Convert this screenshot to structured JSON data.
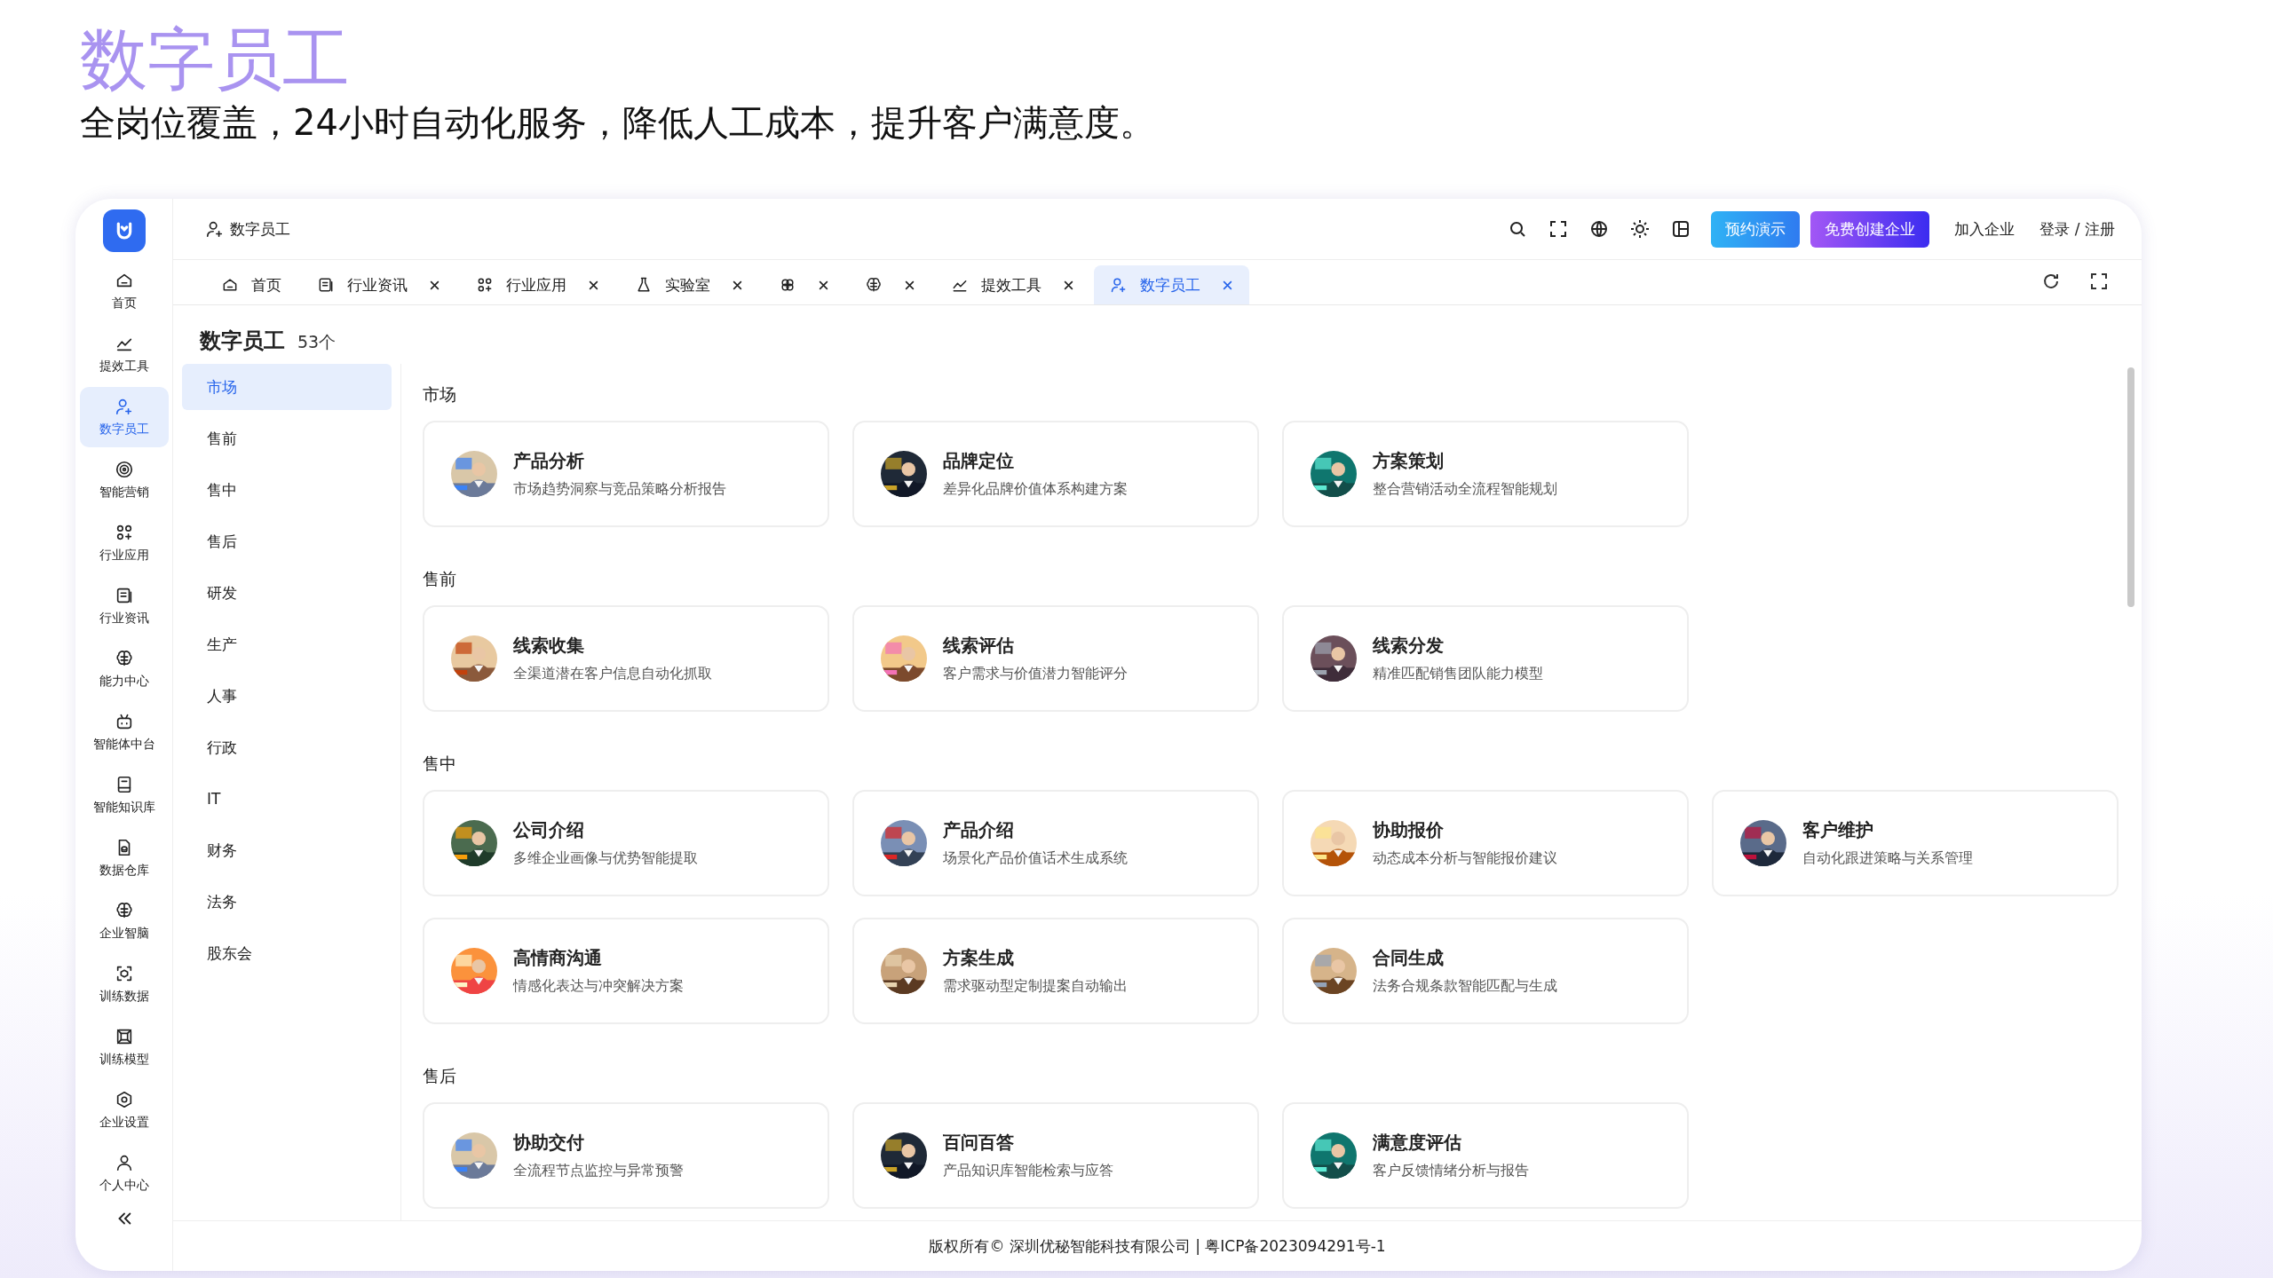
{
  "slide": {
    "title": "数字员工",
    "subtitle": "全岗位覆盖，24小时自动化服务，降低人工成本，提升客户满意度。"
  },
  "sidebar": {
    "items": [
      {
        "label": "首页",
        "selected": false
      },
      {
        "label": "提效工具",
        "selected": false
      },
      {
        "label": "数字员工",
        "selected": true
      },
      {
        "label": "智能营销",
        "selected": false
      },
      {
        "label": "行业应用",
        "selected": false
      },
      {
        "label": "行业资讯",
        "selected": false
      },
      {
        "label": "能力中心",
        "selected": false
      },
      {
        "label": "智能体中台",
        "selected": false
      },
      {
        "label": "智能知识库",
        "selected": false
      },
      {
        "label": "数据仓库",
        "selected": false
      },
      {
        "label": "企业智脑",
        "selected": false
      },
      {
        "label": "训练数据",
        "selected": false
      },
      {
        "label": "训练模型",
        "selected": false
      },
      {
        "label": "企业设置",
        "selected": false
      },
      {
        "label": "个人中心",
        "selected": false
      }
    ]
  },
  "topbar": {
    "breadcrumb": "数字员工",
    "demo_button": "预约演示",
    "create_button": "免费创建企业",
    "join_link": "加入企业",
    "login_link": "登录 / 注册"
  },
  "tabs": [
    {
      "label": "首页",
      "closable": false,
      "selected": false
    },
    {
      "label": "行业资讯",
      "closable": true,
      "selected": false
    },
    {
      "label": "行业应用",
      "closable": true,
      "selected": false
    },
    {
      "label": "实验室",
      "closable": true,
      "selected": false
    },
    {
      "closable": true,
      "selected": false
    },
    {
      "closable": true,
      "selected": false
    },
    {
      "label": "提效工具",
      "closable": true,
      "selected": false
    },
    {
      "label": "数字员工",
      "closable": true,
      "selected": true
    }
  ],
  "page": {
    "title": "数字员工",
    "count": "53个"
  },
  "categories": [
    {
      "label": "市场",
      "selected": true
    },
    {
      "label": "售前",
      "selected": false
    },
    {
      "label": "售中",
      "selected": false
    },
    {
      "label": "售后",
      "selected": false
    },
    {
      "label": "研发",
      "selected": false
    },
    {
      "label": "生产",
      "selected": false
    },
    {
      "label": "人事",
      "selected": false
    },
    {
      "label": "行政",
      "selected": false
    },
    {
      "label": "IT",
      "selected": false
    },
    {
      "label": "财务",
      "selected": false
    },
    {
      "label": "法务",
      "selected": false
    },
    {
      "label": "股东会",
      "selected": false
    }
  ],
  "sections": [
    {
      "title": "市场",
      "cards": [
        {
          "name": "产品分析",
          "desc": "市场趋势洞察与竞品策略分析报告"
        },
        {
          "name": "品牌定位",
          "desc": "差异化品牌价值体系构建方案"
        },
        {
          "name": "方案策划",
          "desc": "整合营销活动全流程智能规划"
        }
      ]
    },
    {
      "title": "售前",
      "cards": [
        {
          "name": "线索收集",
          "desc": "全渠道潜在客户信息自动化抓取"
        },
        {
          "name": "线索评估",
          "desc": "客户需求与价值潜力智能评分"
        },
        {
          "name": "线索分发",
          "desc": "精准匹配销售团队能力模型"
        }
      ]
    },
    {
      "title": "售中",
      "cards": [
        {
          "name": "公司介绍",
          "desc": "多维企业画像与优势智能提取"
        },
        {
          "name": "产品介绍",
          "desc": "场景化产品价值话术生成系统"
        },
        {
          "name": "协助报价",
          "desc": "动态成本分析与智能报价建议"
        },
        {
          "name": "客户维护",
          "desc": "自动化跟进策略与关系管理"
        },
        {
          "name": "高情商沟通",
          "desc": "情感化表达与冲突解决方案"
        },
        {
          "name": "方案生成",
          "desc": "需求驱动型定制提案自动输出"
        },
        {
          "name": "合同生成",
          "desc": "法务合规条款智能匹配与生成"
        }
      ]
    },
    {
      "title": "售后",
      "cards": [
        {
          "name": "协助交付",
          "desc": "全流程节点监控与异常预警"
        },
        {
          "name": "百问百答",
          "desc": "产品知识库智能检索与应答"
        },
        {
          "name": "满意度评估",
          "desc": "客户反馈情绪分析与报告"
        }
      ]
    }
  ],
  "footer": "版权所有© 深圳优秘智能科技有限公司 | 粤ICP备2023094291号-1"
}
